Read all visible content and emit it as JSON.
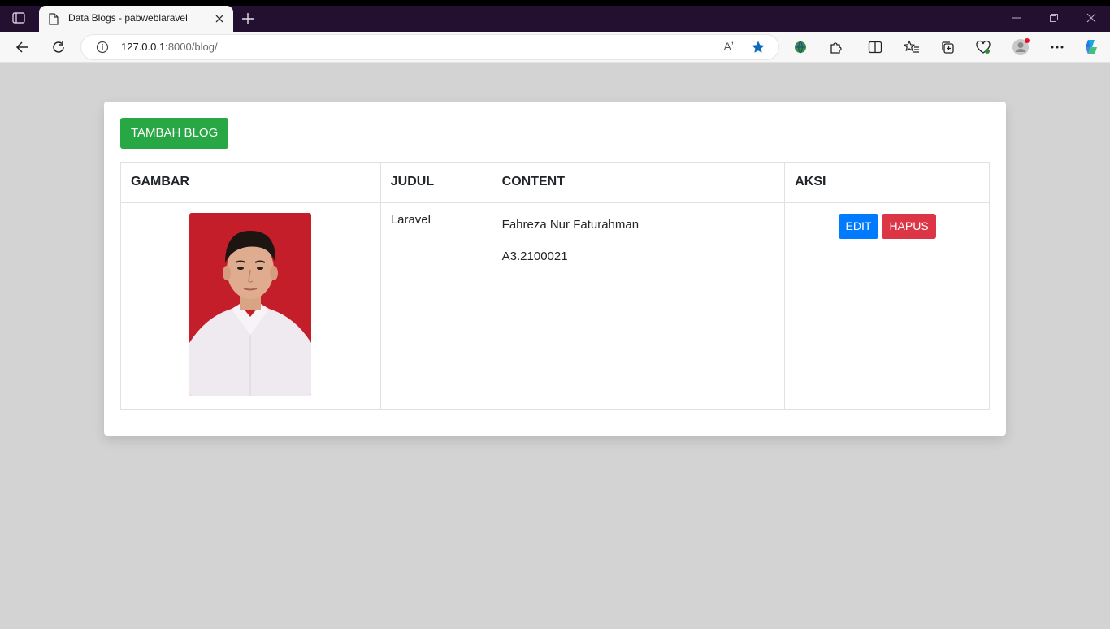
{
  "browser": {
    "tab_title": "Data Blogs - pabweblaravel",
    "url_host": "127.0.0.1:",
    "url_rest": "8000/blog/",
    "read_aloud_label": "Aʼ"
  },
  "page": {
    "add_button_label": "TAMBAH BLOG",
    "table": {
      "headers": [
        "GAMBAR",
        "JUDUL",
        "CONTENT",
        "AKSI"
      ],
      "rows": [
        {
          "judul": "Laravel",
          "content": [
            "Fahreza Nur Faturahman",
            "A3.2100021"
          ],
          "edit_label": "EDIT",
          "delete_label": "HAPUS"
        }
      ]
    }
  },
  "colors": {
    "titlebar": "#230f30",
    "add_button": "#28a745",
    "edit_button": "#007bff",
    "delete_button": "#dc3545",
    "photo_background": "#c41e2a"
  }
}
